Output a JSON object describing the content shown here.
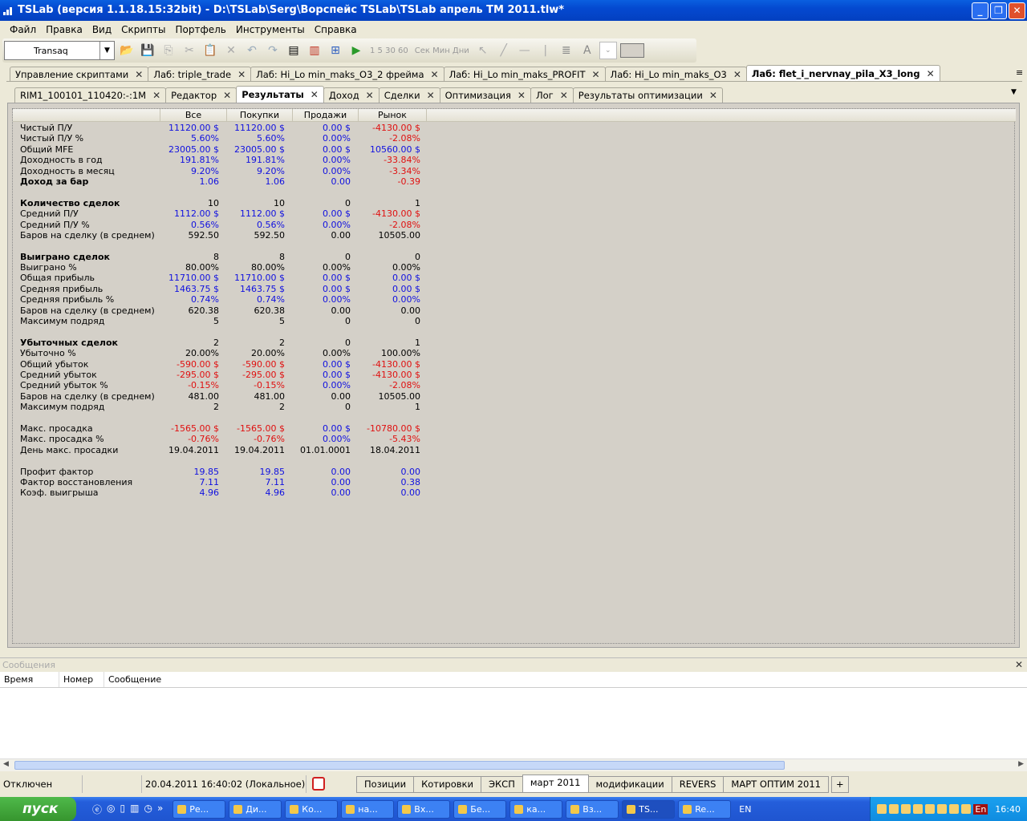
{
  "window": {
    "title": "TSLab (версия 1.1.18.15:32bit) - D:\\TSLab\\Serg\\Ворспейс TSLab\\TSLab апрель  TM 2011.tlw*"
  },
  "menu": [
    "Файл",
    "Правка",
    "Вид",
    "Скрипты",
    "Портфель",
    "Инструменты",
    "Справка"
  ],
  "toolbar": {
    "connector": "Transaq",
    "intervals": "1 5 30 60",
    "units": "Сек Мин Дни"
  },
  "doc_tabs": [
    {
      "label": "Управление скриптами",
      "active": false
    },
    {
      "label": "Лаб: triple_trade",
      "active": false
    },
    {
      "label": "Лаб: Hi_Lo min_maks_O3_2 фрейма",
      "active": false
    },
    {
      "label": "Лаб: Hi_Lo min_maks_PROFIT",
      "active": false
    },
    {
      "label": "Лаб: Hi_Lo min_maks_O3",
      "active": false
    },
    {
      "label": "Лаб: flet_i_nervnay_pila_X3_long",
      "active": true
    }
  ],
  "inner_tabs": [
    {
      "label": "RIM1_100101_110420:-:1M",
      "active": false
    },
    {
      "label": "Редактор",
      "active": false
    },
    {
      "label": "Результаты",
      "active": true
    },
    {
      "label": "Доход",
      "active": false
    },
    {
      "label": "Сделки",
      "active": false
    },
    {
      "label": "Оптимизация",
      "active": false
    },
    {
      "label": "Лог",
      "active": false
    },
    {
      "label": "Результаты оптимизации",
      "active": false
    }
  ],
  "colors": {
    "positive": "#1010e0",
    "negative": "#e01010",
    "neutral": "#000000"
  },
  "results": {
    "columns": [
      "Все",
      "Покупки",
      "Продажи",
      "Рынок"
    ],
    "rows": [
      {
        "label": "Чистый П/У",
        "bold": false,
        "values": [
          "11120.00 $",
          "11120.00 $",
          "0.00 $",
          "-4130.00 $"
        ],
        "colors": [
          "b",
          "b",
          "b",
          "r"
        ]
      },
      {
        "label": "Чистый П/У %",
        "bold": false,
        "values": [
          "5.60%",
          "5.60%",
          "0.00%",
          "-2.08%"
        ],
        "colors": [
          "b",
          "b",
          "b",
          "r"
        ]
      },
      {
        "label": "Общий MFE",
        "bold": false,
        "values": [
          "23005.00 $",
          "23005.00 $",
          "0.00 $",
          "10560.00 $"
        ],
        "colors": [
          "b",
          "b",
          "b",
          "b"
        ]
      },
      {
        "label": "Доходность в год",
        "bold": false,
        "values": [
          "191.81%",
          "191.81%",
          "0.00%",
          "-33.84%"
        ],
        "colors": [
          "b",
          "b",
          "b",
          "r"
        ]
      },
      {
        "label": "Доходность в месяц",
        "bold": false,
        "values": [
          "9.20%",
          "9.20%",
          "0.00%",
          "-3.34%"
        ],
        "colors": [
          "b",
          "b",
          "b",
          "r"
        ]
      },
      {
        "label": "Доход за бар",
        "bold": true,
        "values": [
          "1.06",
          "1.06",
          "0.00",
          "-0.39"
        ],
        "colors": [
          "b",
          "b",
          "b",
          "r"
        ]
      },
      null,
      {
        "label": "Количество сделок",
        "bold": true,
        "values": [
          "10",
          "10",
          "0",
          "1"
        ],
        "colors": [
          "k",
          "k",
          "k",
          "k"
        ]
      },
      {
        "label": "Средний П/У",
        "bold": false,
        "values": [
          "1112.00 $",
          "1112.00 $",
          "0.00 $",
          "-4130.00 $"
        ],
        "colors": [
          "b",
          "b",
          "b",
          "r"
        ]
      },
      {
        "label": "Средний П/У %",
        "bold": false,
        "values": [
          "0.56%",
          "0.56%",
          "0.00%",
          "-2.08%"
        ],
        "colors": [
          "b",
          "b",
          "b",
          "r"
        ]
      },
      {
        "label": "Баров на сделку (в среднем)",
        "bold": false,
        "values": [
          "592.50",
          "592.50",
          "0.00",
          "10505.00"
        ],
        "colors": [
          "k",
          "k",
          "k",
          "k"
        ]
      },
      null,
      {
        "label": "Выиграно сделок",
        "bold": true,
        "values": [
          "8",
          "8",
          "0",
          "0"
        ],
        "colors": [
          "k",
          "k",
          "k",
          "k"
        ]
      },
      {
        "label": "Выиграно %",
        "bold": false,
        "values": [
          "80.00%",
          "80.00%",
          "0.00%",
          "0.00%"
        ],
        "colors": [
          "k",
          "k",
          "k",
          "k"
        ]
      },
      {
        "label": "Общая прибыль",
        "bold": false,
        "values": [
          "11710.00 $",
          "11710.00 $",
          "0.00 $",
          "0.00 $"
        ],
        "colors": [
          "b",
          "b",
          "b",
          "b"
        ]
      },
      {
        "label": "Средняя прибыль",
        "bold": false,
        "values": [
          "1463.75 $",
          "1463.75 $",
          "0.00 $",
          "0.00 $"
        ],
        "colors": [
          "b",
          "b",
          "b",
          "b"
        ]
      },
      {
        "label": "Средняя прибыль %",
        "bold": false,
        "values": [
          "0.74%",
          "0.74%",
          "0.00%",
          "0.00%"
        ],
        "colors": [
          "b",
          "b",
          "b",
          "b"
        ]
      },
      {
        "label": "Баров на сделку (в среднем)",
        "bold": false,
        "values": [
          "620.38",
          "620.38",
          "0.00",
          "0.00"
        ],
        "colors": [
          "k",
          "k",
          "k",
          "k"
        ]
      },
      {
        "label": "Максимум подряд",
        "bold": false,
        "values": [
          "5",
          "5",
          "0",
          "0"
        ],
        "colors": [
          "k",
          "k",
          "k",
          "k"
        ]
      },
      null,
      {
        "label": "Убыточных сделок",
        "bold": true,
        "values": [
          "2",
          "2",
          "0",
          "1"
        ],
        "colors": [
          "k",
          "k",
          "k",
          "k"
        ]
      },
      {
        "label": "Убыточно %",
        "bold": false,
        "values": [
          "20.00%",
          "20.00%",
          "0.00%",
          "100.00%"
        ],
        "colors": [
          "k",
          "k",
          "k",
          "k"
        ]
      },
      {
        "label": "Общий убыток",
        "bold": false,
        "values": [
          "-590.00 $",
          "-590.00 $",
          "0.00 $",
          "-4130.00 $"
        ],
        "colors": [
          "r",
          "r",
          "b",
          "r"
        ]
      },
      {
        "label": "Средний убыток",
        "bold": false,
        "values": [
          "-295.00 $",
          "-295.00 $",
          "0.00 $",
          "-4130.00 $"
        ],
        "colors": [
          "r",
          "r",
          "b",
          "r"
        ]
      },
      {
        "label": "Средний убыток %",
        "bold": false,
        "values": [
          "-0.15%",
          "-0.15%",
          "0.00%",
          "-2.08%"
        ],
        "colors": [
          "r",
          "r",
          "b",
          "r"
        ]
      },
      {
        "label": "Баров на сделку (в среднем)",
        "bold": false,
        "values": [
          "481.00",
          "481.00",
          "0.00",
          "10505.00"
        ],
        "colors": [
          "k",
          "k",
          "k",
          "k"
        ]
      },
      {
        "label": "Максимум подряд",
        "bold": false,
        "values": [
          "2",
          "2",
          "0",
          "1"
        ],
        "colors": [
          "k",
          "k",
          "k",
          "k"
        ]
      },
      null,
      {
        "label": "Макс. просадка",
        "bold": false,
        "values": [
          "-1565.00 $",
          "-1565.00 $",
          "0.00 $",
          "-10780.00 $"
        ],
        "colors": [
          "r",
          "r",
          "b",
          "r"
        ]
      },
      {
        "label": "Макс. просадка %",
        "bold": false,
        "values": [
          "-0.76%",
          "-0.76%",
          "0.00%",
          "-5.43%"
        ],
        "colors": [
          "r",
          "r",
          "b",
          "r"
        ]
      },
      {
        "label": "День макс. просадки",
        "bold": false,
        "values": [
          "19.04.2011",
          "19.04.2011",
          "01.01.0001",
          "18.04.2011"
        ],
        "colors": [
          "k",
          "k",
          "k",
          "k"
        ]
      },
      null,
      {
        "label": "Профит фактор",
        "bold": false,
        "values": [
          "19.85",
          "19.85",
          "0.00",
          "0.00"
        ],
        "colors": [
          "b",
          "b",
          "b",
          "b"
        ]
      },
      {
        "label": "Фактор восстановления",
        "bold": false,
        "values": [
          "7.11",
          "7.11",
          "0.00",
          "0.38"
        ],
        "colors": [
          "b",
          "b",
          "b",
          "b"
        ]
      },
      {
        "label": "Коэф. выигрыша",
        "bold": false,
        "values": [
          "4.96",
          "4.96",
          "0.00",
          "0.00"
        ],
        "colors": [
          "b",
          "b",
          "b",
          "b"
        ]
      }
    ]
  },
  "messages": {
    "title": "Сообщения",
    "columns": [
      "Время",
      "Номер",
      "Сообщение"
    ]
  },
  "status": {
    "connection": "Отключен",
    "datetime": "20.04.2011 16:40:02 (Локальное)"
  },
  "bottom_tabs": [
    {
      "label": "Позиции",
      "active": false
    },
    {
      "label": "Котировки",
      "active": false
    },
    {
      "label": "ЭКСП",
      "active": false
    },
    {
      "label": "март 2011",
      "active": true
    },
    {
      "label": "модификации",
      "active": false
    },
    {
      "label": "REVERS",
      "active": false
    },
    {
      "label": "МАРТ ОПТИМ 2011",
      "active": false
    }
  ],
  "bottom_add": "+",
  "taskbar": {
    "start": "пуск",
    "tasks": [
      "Ре...",
      "Ди...",
      "Ко...",
      "на...",
      "Вх...",
      "Бе...",
      "ка...",
      "Вз...",
      "TS...",
      "Re..."
    ],
    "active_task": 8,
    "lang": "EN",
    "tray_lang": "En",
    "clock": "16:40"
  }
}
